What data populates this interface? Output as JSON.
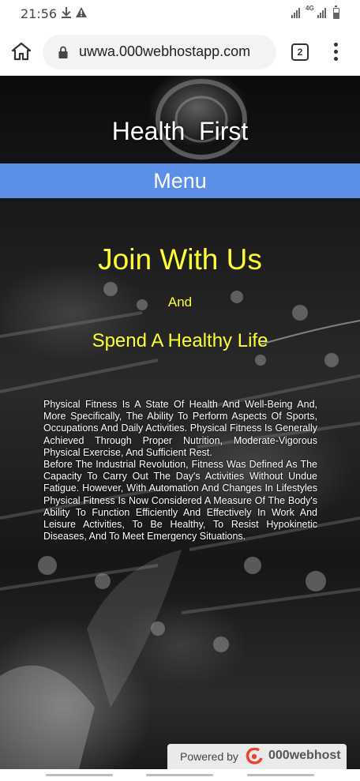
{
  "status_bar": {
    "time": "21:56",
    "download_icon": "download-arrow-icon",
    "warning_icon": "warning-triangle-icon",
    "network_label": "4G",
    "battery_icon": "battery-icon"
  },
  "browser": {
    "url": "uwwa.000webhostapp.com",
    "tab_count": "2",
    "home_icon": "home-icon",
    "lock_icon": "lock-icon",
    "menu_icon": "more-vert-icon"
  },
  "page": {
    "header_title": "Health  First",
    "menu_label": "Menu",
    "join_heading": "Join With Us",
    "and_text": "And",
    "spend_heading": "Spend A Healthy Life",
    "paragraph_1": "Physical Fitness Is A State Of Health And Well-Being And, More Specifically, The Ability To Perform Aspects Of Sports, Occupations And Daily Activities. Physical Fitness Is Generally Achieved Through Proper Nutrition, Moderate-Vigorous Physical Exercise, And Sufficient Rest.",
    "paragraph_2": "Before The Industrial Revolution, Fitness Was Defined As The Capacity To Carry Out The Day's Activities Without Undue Fatigue. However, With Automation And Changes In Lifestyles Physical Fitness Is Now Considered A Measure Of The Body's Ability To Function Efficiently And Effectively In Work And Leisure Activities, To Be Healthy, To Resist Hypokinetic Diseases, And To Meet Emergency Situations.",
    "colors": {
      "menu_bar": "#5b8fe8",
      "heading_yellow": "#ffff33"
    }
  },
  "badge": {
    "powered_by": "Powered by",
    "brand": "000webhost"
  }
}
